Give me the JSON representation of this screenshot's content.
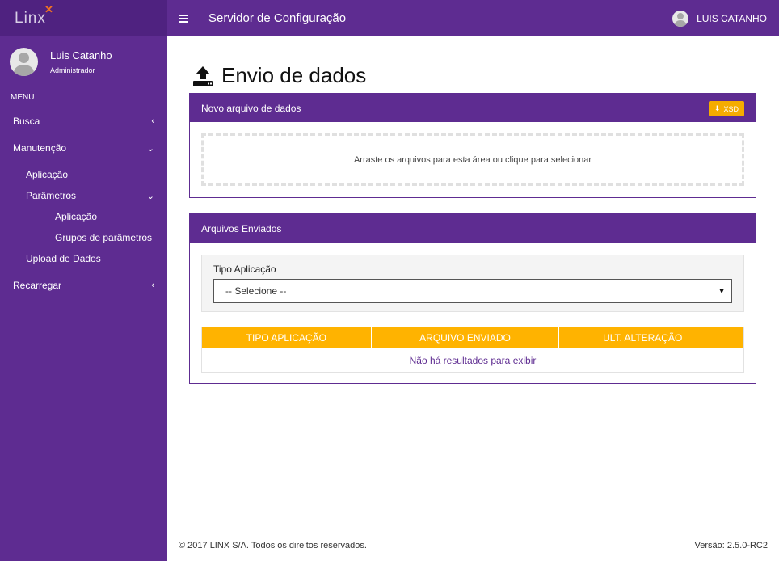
{
  "brand": {
    "logo_text": "Linx"
  },
  "user": {
    "name": "Luis Catanho",
    "role": "Administrador",
    "top_name": "LUIS CATANHO"
  },
  "sidebar": {
    "menu_header": "MENU",
    "items": [
      {
        "label": "Busca",
        "icon": "chevron-left-icon"
      },
      {
        "label": "Manutenção",
        "icon": "chevron-down-icon"
      },
      {
        "label": "Aplicação"
      },
      {
        "label": "Parâmetros",
        "icon": "chevron-down-icon"
      },
      {
        "label": "Aplicação"
      },
      {
        "label": "Grupos de parâmetros"
      },
      {
        "label": "Upload de Dados"
      },
      {
        "label": "Recarregar",
        "icon": "chevron-left-icon"
      }
    ]
  },
  "header": {
    "title": "Servidor de Configuração"
  },
  "page": {
    "title": "Envio de dados"
  },
  "upload_panel": {
    "title": "Novo arquivo de dados",
    "xsd_label": "XSD",
    "drop_text": "Arraste os arquivos para esta área ou clique para selecionar"
  },
  "files_panel": {
    "title": "Arquivos Enviados",
    "filter_label": "Tipo Aplicação",
    "select_value": "-- Selecione --",
    "columns": [
      "TIPO APLICAÇÃO",
      "ARQUIVO ENVIADO",
      "ULT. ALTERAÇÃO"
    ],
    "empty_text": "Não há resultados para exibir"
  },
  "footer": {
    "copyright": "© 2017 LINX S/A. Todos os direitos reservados.",
    "version": "Versão: 2.5.0-RC2"
  },
  "colors": {
    "primary": "#5e2c91",
    "accent": "#ffb300",
    "button": "#f5ac00"
  }
}
